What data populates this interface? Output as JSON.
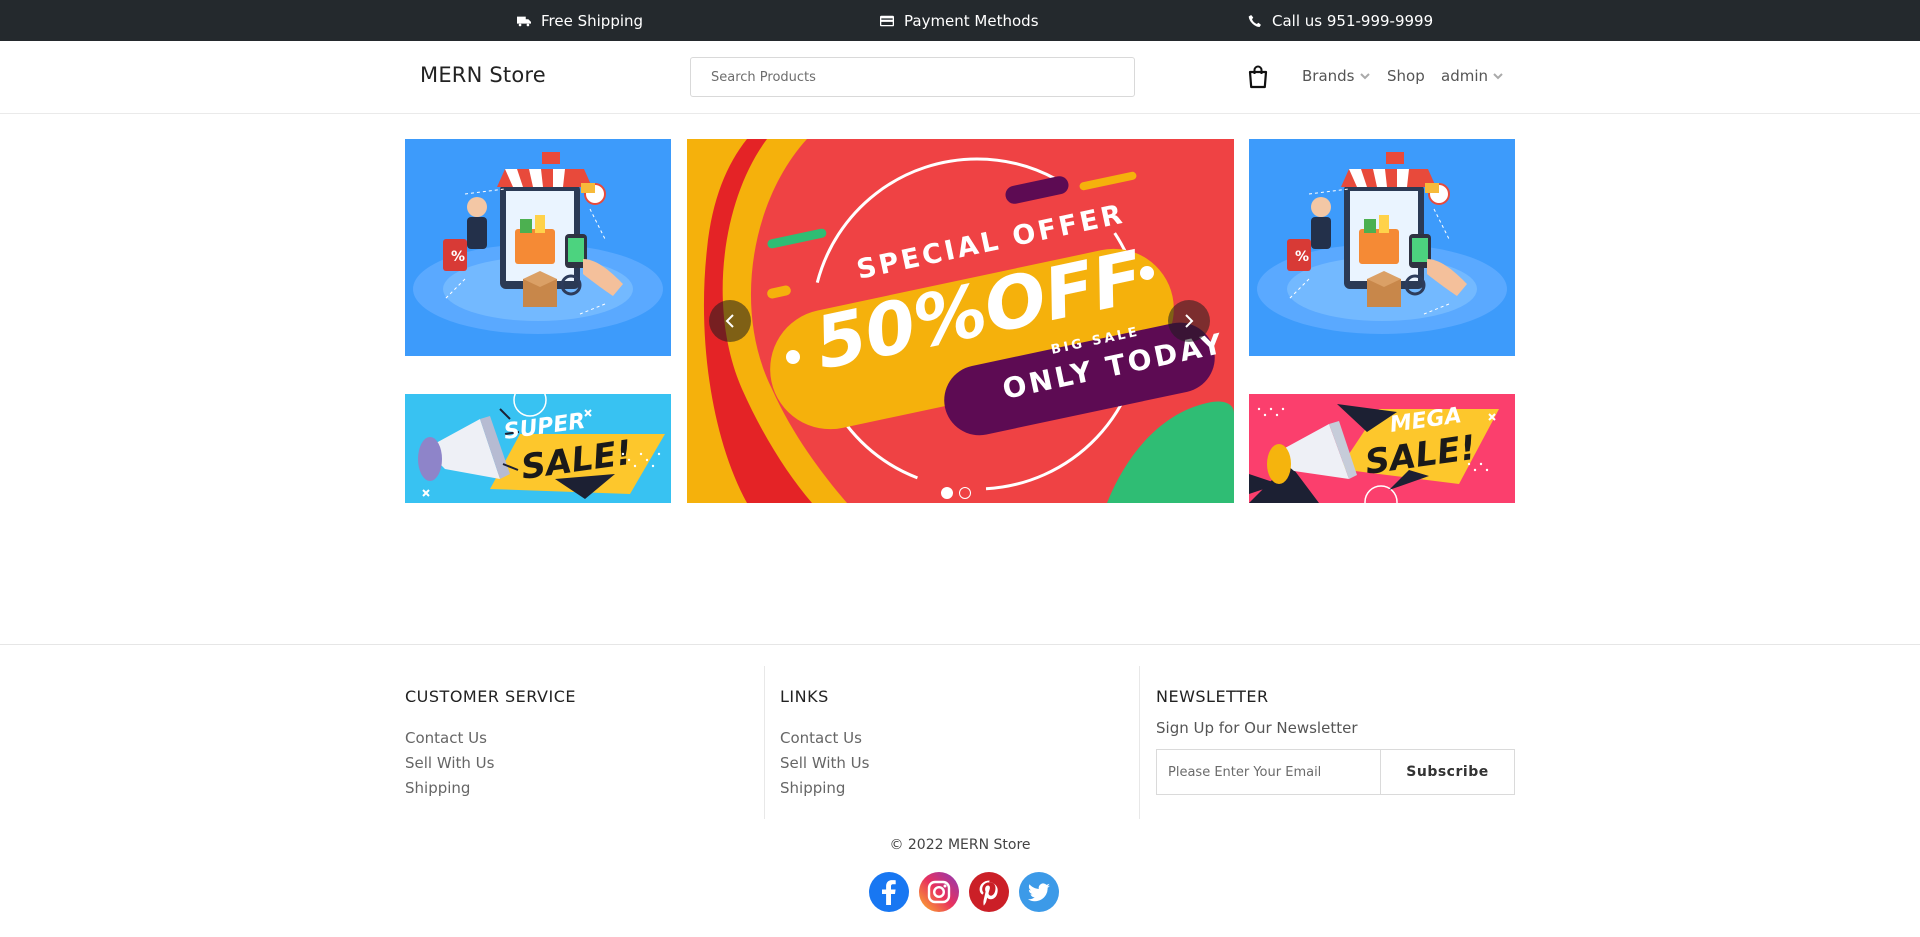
{
  "topbar": {
    "shipping": {
      "label": "Free Shipping",
      "icon": "truck-icon"
    },
    "payment": {
      "label": "Payment Methods",
      "icon": "credit-card-icon"
    },
    "call": {
      "label": "Call us 951-999-9999",
      "icon": "phone-icon"
    }
  },
  "header": {
    "brand": "MERN Store",
    "search_placeholder": "Search Products",
    "cart_icon": "shopping-bag-icon",
    "nav": {
      "brands": "Brands",
      "shop": "Shop",
      "user": "admin"
    }
  },
  "hero": {
    "left_top": {
      "icon": "online-shopping-illustration"
    },
    "left_bottom": {
      "line1": "SUPER",
      "line2": "SALE!"
    },
    "center": {
      "line1": "SPECIAL OFFER",
      "line2": "50%OFF",
      "line3": "BIG SALE",
      "line4": "ONLY TODAY"
    },
    "right_top": {
      "icon": "online-shopping-illustration"
    },
    "right_bottom": {
      "line1": "MEGA",
      "line2": "SALE!"
    },
    "slider_dots": 2,
    "active_dot": 0
  },
  "footer": {
    "customer_service": {
      "title": "CUSTOMER SERVICE",
      "links": [
        "Contact Us",
        "Sell With Us",
        "Shipping"
      ]
    },
    "links": {
      "title": "LINKS",
      "links": [
        "Contact Us",
        "Sell With Us",
        "Shipping"
      ]
    },
    "newsletter": {
      "title": "NEWSLETTER",
      "subtitle": "Sign Up for Our Newsletter",
      "placeholder": "Please Enter Your Email",
      "button": "Subscribe"
    },
    "copyright": "© 2022 MERN Store",
    "social": [
      "facebook-icon",
      "instagram-icon",
      "pinterest-icon",
      "twitter-icon"
    ]
  },
  "colors": {
    "topbar_bg": "#24292d",
    "banner_blue": "#3d9bfb",
    "banner_red": "#ee3f43",
    "banner_yellow": "#f6b40a",
    "banner_purple": "#5d0b53",
    "mega_pink": "#fb3f6d",
    "super_cyan": "#39c3f3"
  }
}
